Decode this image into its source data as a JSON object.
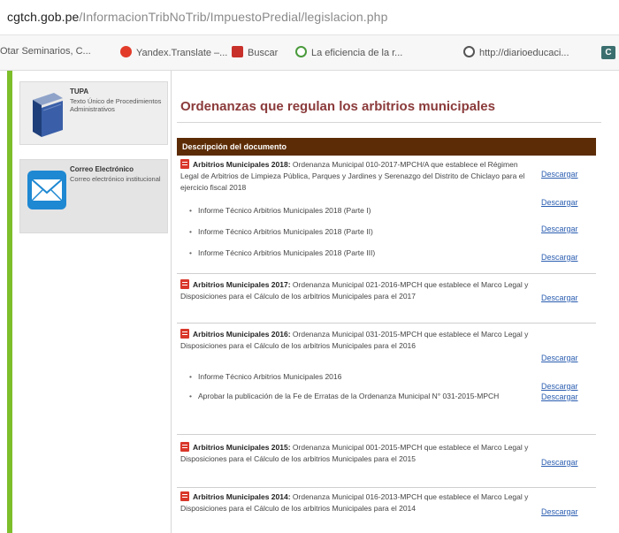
{
  "browser": {
    "url_domain": "cgtch.gob.pe",
    "url_path": "/InformacionTribNoTrib/ImpuestoPredial/legislacion.php",
    "bookmarks": [
      {
        "label": "Otar Seminarios, C...",
        "icon": "bookmark-folder-icon"
      },
      {
        "label": "Yandex.Translate –...",
        "icon": "yandex-icon"
      },
      {
        "label": "Buscar",
        "icon": "search-flag-icon"
      },
      {
        "label": "La eficiencia de la r...",
        "icon": "google-icon"
      },
      {
        "label": "http://diarioeducaci...",
        "icon": "globe-icon"
      }
    ],
    "bookmark_end_glyph": "C"
  },
  "sidebar": {
    "cards": [
      {
        "title": "TUPA",
        "description": "Texto Único de Procedimientos Administrativos",
        "icon": "book-icon"
      },
      {
        "title": "Correo Electrónico",
        "description": "Correo electrónico institucional",
        "icon": "envelope-icon"
      }
    ]
  },
  "main": {
    "title": "Ordenanzas que regulan los arbitrios municipales",
    "table_header": "Descripción del documento",
    "download_label": "Descargar",
    "entries": [
      {
        "bold": "Arbitrios Municipales 2018:",
        "text": " Ordenanza Municipal 010-2017-MPCH/A que establece el Régimen Legal de Arbitrios de Limpieza Pública, Parques y Jardines y Serenazgo del Distrito de Chiclayo para el ejercicio fiscal 2018",
        "subitems": [
          "Informe Técnico Arbitrios Municipales 2018 (Parte I)",
          "Informe Técnico Arbitrios Municipales 2018 (Parte II)",
          "Informe Técnico Arbitrios Municipales 2018 (Parte III)"
        ]
      },
      {
        "bold": "Arbitrios Municipales 2017:",
        "text": " Ordenanza Municipal 021-2016-MPCH que establece el Marco Legal y Disposiciones para el Cálculo de los arbitrios Municipales para el 2017",
        "subitems": []
      },
      {
        "bold": "Arbitrios Municipales 2016:",
        "text": " Ordenanza Municipal 031-2015-MPCH que establece el Marco Legal y Disposiciones para el Cálculo de los arbitrios Municipales para el 2016",
        "subitems": [
          "Informe Técnico Arbitrios Municipales 2016",
          "Aprobar la publicación de la Fe de Erratas de la Ordenanza Municipal N° 031-2015-MPCH"
        ]
      },
      {
        "bold": "Arbitrios Municipales 2015:",
        "text": " Ordenanza Municipal 001-2015-MPCH que establece el Marco Legal y Disposiciones para el Cálculo de los arbitrios Municipales para el 2015",
        "subitems": []
      },
      {
        "bold": "Arbitrios Municipales 2014:",
        "text": " Ordenanza Municipal 016-2013-MPCH que establece el Marco Legal y Disposiciones para el Cálculo de los arbitrios Municipales para el 2014",
        "subitems": []
      }
    ]
  },
  "colors": {
    "accent_green": "#7dbe2b",
    "header_brown": "#5c2c06",
    "title_red": "#8b3a3a",
    "link_blue": "#2a5db0"
  }
}
